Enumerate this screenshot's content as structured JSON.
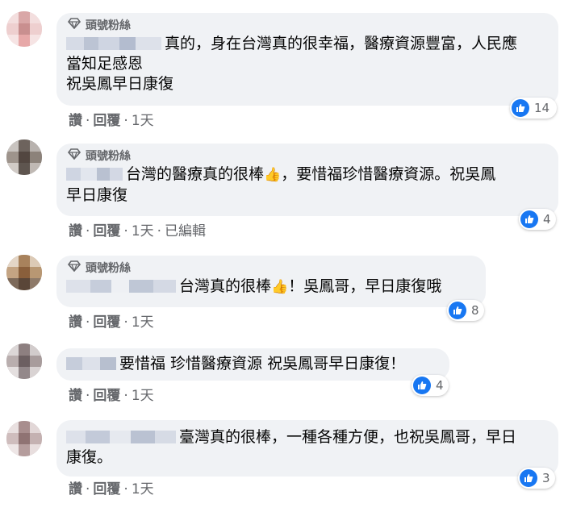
{
  "badge_label": "頭號粉絲",
  "like_color": "#1877f2",
  "comments": [
    {
      "badge": true,
      "lines": [
        "真的，身在台灣真的很幸福，醫療資源豐富，人民應",
        "當知足感恩",
        "祝吳鳳早日康復"
      ],
      "reactions": "14",
      "actions": {
        "like": "讚",
        "reply": "回覆",
        "time": "1天",
        "edited": ""
      }
    },
    {
      "badge": true,
      "lines": [
        "台灣的醫療真的很棒",
        "，要惜福珍惜醫療資源。祝吳鳳",
        "早日康復"
      ],
      "reactions": "4",
      "actions": {
        "like": "讚",
        "reply": "回覆",
        "time": "1天",
        "edited": "已編輯"
      }
    },
    {
      "badge": true,
      "lines": [
        "台灣真的很棒",
        "！吳鳳哥，早日康復哦"
      ],
      "reactions": "8",
      "actions": {
        "like": "讚",
        "reply": "回覆",
        "time": "1天",
        "edited": ""
      }
    },
    {
      "badge": false,
      "lines": [
        "要惜福 珍惜醫療資源 祝吳鳳哥早日康復！"
      ],
      "reactions": "4",
      "actions": {
        "like": "讚",
        "reply": "回覆",
        "time": "1天",
        "edited": ""
      }
    },
    {
      "badge": false,
      "lines": [
        "臺灣真的很棒，一種各種方便，也祝吳鳳哥，早日",
        "康復。"
      ],
      "reactions": "3",
      "actions": {
        "like": "讚",
        "reply": "回覆",
        "time": "1天",
        "edited": ""
      }
    }
  ]
}
